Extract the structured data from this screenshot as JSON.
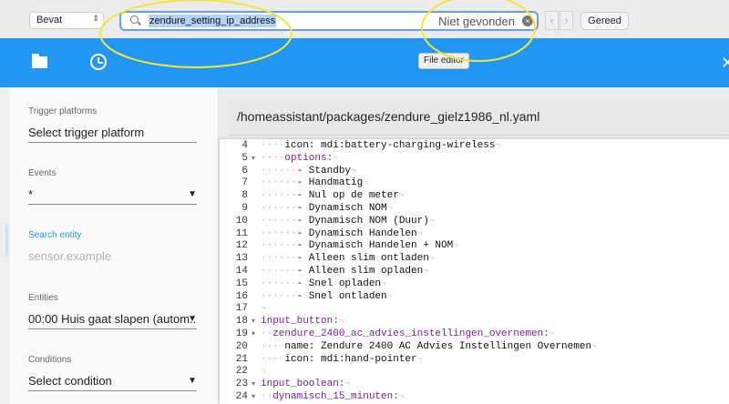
{
  "findbar": {
    "mode_select": "Bevat",
    "query": "zendure_setting_ip_address",
    "status": "Niet gevonden",
    "prev_arrow": "‹",
    "next_arrow": "›",
    "done_label": "Gereed"
  },
  "appbar": {
    "tooltip": "File editor",
    "close_glyph": "✕",
    "color": "#2196f3"
  },
  "sidebar": {
    "trigger_platforms": {
      "label": "Trigger platforms",
      "value": "Select trigger platform"
    },
    "events": {
      "label": "Events",
      "value": "*"
    },
    "search_entity": {
      "label": "Search entity",
      "placeholder": "sensor.example"
    },
    "entities": {
      "label": "Entities",
      "value": "00:00 Huis gaat slapen (autom..."
    },
    "conditions": {
      "label": "Conditions",
      "value": "Select condition"
    }
  },
  "editor": {
    "path": "/homeassistant/packages/zendure_gielz1986_nl.yaml",
    "lines": [
      {
        "n": "4",
        "fold": "",
        "indent": "····",
        "key": "",
        "text": "icon: mdi:battery-charging-wireless"
      },
      {
        "n": "5",
        "fold": "▾",
        "indent": "····",
        "key": "options:",
        "text": ""
      },
      {
        "n": "6",
        "fold": "",
        "indent": "······",
        "key": "",
        "text": "- Standby"
      },
      {
        "n": "7",
        "fold": "",
        "indent": "······",
        "key": "",
        "text": "- Handmatig"
      },
      {
        "n": "8",
        "fold": "",
        "indent": "······",
        "key": "",
        "text": "- Nul op de meter"
      },
      {
        "n": "9",
        "fold": "",
        "indent": "······",
        "key": "",
        "text": "- Dynamisch NOM"
      },
      {
        "n": "10",
        "fold": "",
        "indent": "······",
        "key": "",
        "text": "- Dynamisch NOM (Duur)"
      },
      {
        "n": "11",
        "fold": "",
        "indent": "······",
        "key": "",
        "text": "- Dynamisch Handelen"
      },
      {
        "n": "12",
        "fold": "",
        "indent": "······",
        "key": "",
        "text": "- Dynamisch Handelen + NOM"
      },
      {
        "n": "13",
        "fold": "",
        "indent": "······",
        "key": "",
        "text": "- Alleen slim ontladen"
      },
      {
        "n": "14",
        "fold": "",
        "indent": "······",
        "key": "",
        "text": "- Alleen slim opladen"
      },
      {
        "n": "15",
        "fold": "",
        "indent": "······",
        "key": "",
        "text": "- Snel opladen"
      },
      {
        "n": "16",
        "fold": "",
        "indent": "······",
        "key": "",
        "text": "- Snel ontladen"
      },
      {
        "n": "17",
        "fold": "",
        "indent": "",
        "key": "",
        "text": ""
      },
      {
        "n": "18",
        "fold": "▾",
        "indent": "",
        "key": "input_button:",
        "text": ""
      },
      {
        "n": "19",
        "fold": "▾",
        "indent": "··",
        "key": "zendure_2400_ac_advies_instellingen_overnemen:",
        "text": ""
      },
      {
        "n": "20",
        "fold": "",
        "indent": "····",
        "key": "",
        "text": "name: Zendure 2400 AC Advies Instellingen Overnemen"
      },
      {
        "n": "21",
        "fold": "",
        "indent": "····",
        "key": "",
        "text": "icon: mdi:hand-pointer"
      },
      {
        "n": "22",
        "fold": "",
        "indent": "",
        "key": "",
        "text": ""
      },
      {
        "n": "23",
        "fold": "▾",
        "indent": "",
        "key": "input_boolean:",
        "text": ""
      },
      {
        "n": "24",
        "fold": "▾",
        "indent": "··",
        "key": "dynamisch_15_minuten:",
        "text": ""
      }
    ]
  }
}
